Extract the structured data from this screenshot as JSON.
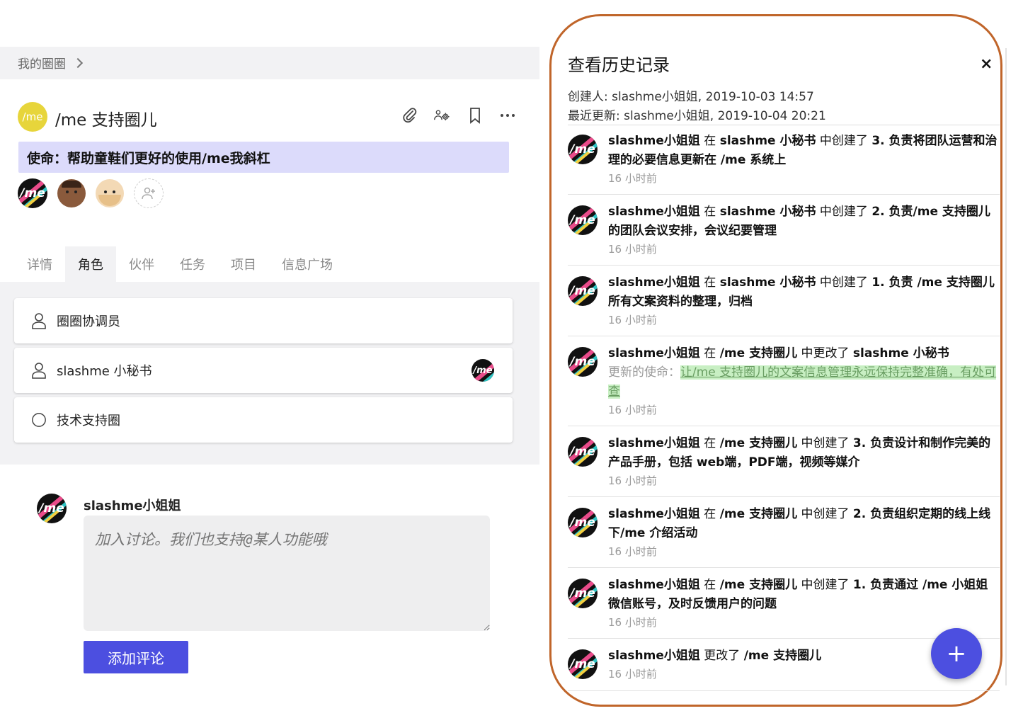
{
  "breadcrumb": {
    "label": "我的圈圈"
  },
  "circle": {
    "logo_text": "/me",
    "title": "/me 支持圈儿",
    "mission": "使命：帮助童鞋们更好的使用/me我斜杠"
  },
  "tabs": [
    {
      "label": "详情",
      "active": false
    },
    {
      "label": "角色",
      "active": true
    },
    {
      "label": "伙伴",
      "active": false
    },
    {
      "label": "任务",
      "active": false
    },
    {
      "label": "项目",
      "active": false
    },
    {
      "label": "信息广场",
      "active": false
    }
  ],
  "roles": [
    {
      "label": "圈圈协调员",
      "icon": "user-icon"
    },
    {
      "label": "slashme 小秘书",
      "icon": "user-icon"
    },
    {
      "label": "技术支持圈",
      "icon": "circle-icon"
    }
  ],
  "comment": {
    "user": "slashme小姐姐",
    "placeholder": "加入讨论。我们也支持@某人功能哦",
    "submit_label": "添加评论"
  },
  "history": {
    "title": "查看历史记录",
    "close_label": "×",
    "created": "创建人: slashme小姐姐, 2019-10-03 14:57",
    "updated": "最近更新: slashme小姐姐, 2019-10-04 20:21",
    "items": [
      {
        "actor": "slashme小姐姐",
        "in_word": " 在 ",
        "target": "slashme 小秘书",
        "verb": " 中创建了 ",
        "object": "3. 负责将团队运营和治理的必要信息更新在 /me 系统上",
        "time": "16 小时前"
      },
      {
        "actor": "slashme小姐姐",
        "in_word": " 在 ",
        "target": "slashme 小秘书",
        "verb": " 中创建了 ",
        "object": "2. 负责/me 支持圈儿的团队会议安排，会议纪要管理",
        "time": "16 小时前"
      },
      {
        "actor": "slashme小姐姐",
        "in_word": " 在 ",
        "target": "slashme 小秘书",
        "verb": " 中创建了 ",
        "object": "1. 负责 /me 支持圈儿所有文案资料的整理，归档",
        "time": "16 小时前"
      },
      {
        "actor": "slashme小姐姐",
        "in_word": " 在 ",
        "target": "/me 支持圈儿",
        "verb": " 中更改了 ",
        "object": "slashme 小秘书",
        "update_label": "更新的使命：",
        "update_value": "让/me 支持圈儿的文案信息管理永远保持完整准确，有处可查",
        "time": "16 小时前"
      },
      {
        "actor": "slashme小姐姐",
        "in_word": " 在 ",
        "target": "/me 支持圈儿",
        "verb": " 中创建了 ",
        "object": "3. 负责设计和制作完美的产品手册，包括 web端，PDF端，视频等媒介",
        "time": "16 小时前"
      },
      {
        "actor": "slashme小姐姐",
        "in_word": " 在 ",
        "target": "/me 支持圈儿",
        "verb": " 中创建了 ",
        "object": "2. 负责组织定期的线上线下/me 介绍活动",
        "time": "16 小时前"
      },
      {
        "actor": "slashme小姐姐",
        "in_word": " 在 ",
        "target": "/me 支持圈儿",
        "verb": " 中创建了 ",
        "object": "1. 负责通过 /me 小姐姐 微信账号，及时反馈用户的问题",
        "time": "16 小时前"
      },
      {
        "actor": "slashme小姐姐",
        "verb": " 更改了 ",
        "object": "/me 支持圈儿",
        "time": "16 小时前"
      }
    ]
  },
  "fab_label": "+",
  "colors": {
    "accent": "#4c4fe0",
    "mission_bg": "#dcdbfb",
    "logo_yellow": "#e7d53b",
    "highlight_border": "#c0652a",
    "updated_bg": "#c8efc3"
  }
}
